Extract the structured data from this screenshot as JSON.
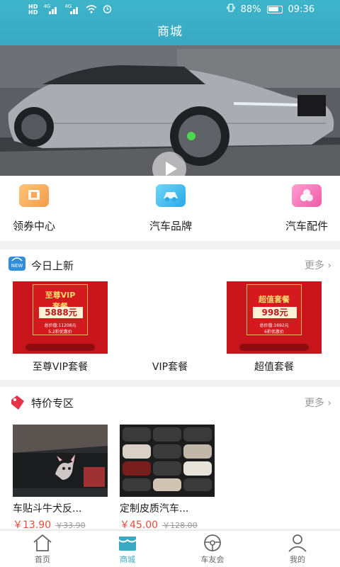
{
  "status": {
    "left_icons": [
      "hd-icon",
      "signal-4g-icon",
      "signal-4g-icon",
      "wifi-icon",
      "alarm-icon"
    ],
    "battery": "88%",
    "time": "09:36",
    "left_text_1": "HD",
    "left_text_2": "4G"
  },
  "header": {
    "title": "商城"
  },
  "banner": {
    "dots": 4,
    "active_dot": 1
  },
  "categories": [
    {
      "label": "领券中心",
      "icon": "coupon-icon",
      "color": "#f5a65b"
    },
    {
      "label": "汽车品牌",
      "icon": "car-brand-icon",
      "color": "#3bb8e8"
    },
    {
      "label": "汽车配件",
      "icon": "car-parts-icon",
      "color": "#f06ab0"
    }
  ],
  "new_today": {
    "title": "今日上新",
    "more": "更多",
    "items": [
      {
        "name": "至尊VIP套餐",
        "poster_title": "至尊VIP\n套餐",
        "price": "5888元",
        "total": "总价值:11208元",
        "discount": "5.2折优惠价"
      },
      {
        "name": "VIP套餐"
      },
      {
        "name": "超值套餐",
        "poster_title": "超值套餐",
        "price": "998元",
        "total": "总价值:1692元",
        "discount": "6折优惠价"
      }
    ]
  },
  "special": {
    "title": "特价专区",
    "more": "更多",
    "items": [
      {
        "name": "车贴斗牛犬反...",
        "price": "￥13.90",
        "orig": "￥33.90"
      },
      {
        "name": "定制皮质汽车...",
        "price": "￥45.00",
        "orig": "￥128.00"
      }
    ]
  },
  "tabbar": [
    {
      "label": "首页",
      "icon": "home-icon"
    },
    {
      "label": "商城",
      "icon": "shop-icon",
      "active": true
    },
    {
      "label": "车友会",
      "icon": "steering-wheel-icon"
    },
    {
      "label": "我的",
      "icon": "user-icon"
    }
  ],
  "colors": {
    "accent": "#3aa9c4",
    "price": "#e94a3b",
    "poster_red": "#c8141b"
  }
}
